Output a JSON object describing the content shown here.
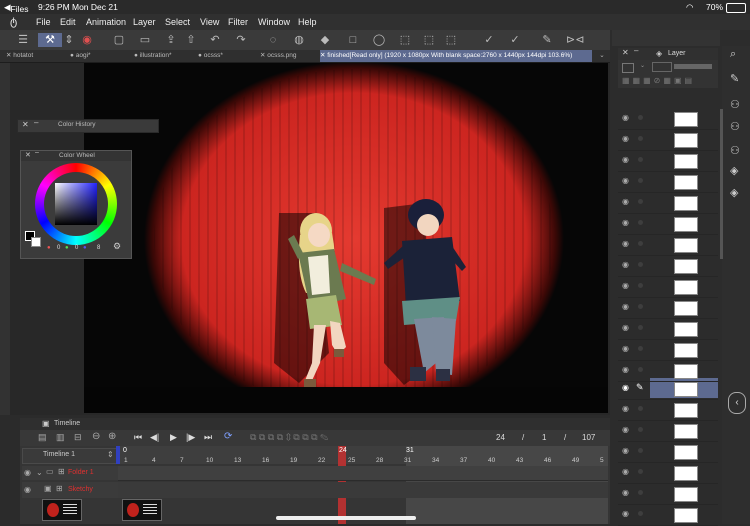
{
  "status": {
    "back_app": "Files",
    "time": "9:26 PM",
    "date": "Mon Dec 21",
    "battery": "70%"
  },
  "menu": [
    "File",
    "Edit",
    "Animation",
    "Layer",
    "Select",
    "View",
    "Filter",
    "Window",
    "Help"
  ],
  "tabs": [
    "hotatot",
    "aogi*",
    "illustration*",
    "ocsss*",
    "ocsss.png",
    "finished[Read only] (1920 x 1080px With blank space:2760 x 1440px 144dpi 103.6%)"
  ],
  "panels": {
    "color_history_title": "Color History",
    "color_wheel_title": "Color Wheel",
    "color_values": [
      "0",
      "0",
      "8"
    ],
    "layer_tab": "Layer"
  },
  "timeline": {
    "title": "Timeline",
    "name": "Timeline 1",
    "frame_current": "24",
    "frame_slash1": "/",
    "frame_one": "1",
    "frame_slash2": "/",
    "frame_total": "107",
    "marker_current": "24",
    "marker_end": "31",
    "marker_start": "0",
    "ticks": [
      "1",
      "4",
      "7",
      "10",
      "13",
      "16",
      "19",
      "22",
      "25",
      "28",
      "31",
      "34",
      "37",
      "40",
      "43",
      "46",
      "49",
      "5"
    ],
    "tracks": [
      "Folder 1",
      "Sketchy"
    ]
  },
  "colors": {
    "accent": "#5d6a90",
    "curtain": "#d12a24",
    "track_red": "#e03030"
  }
}
